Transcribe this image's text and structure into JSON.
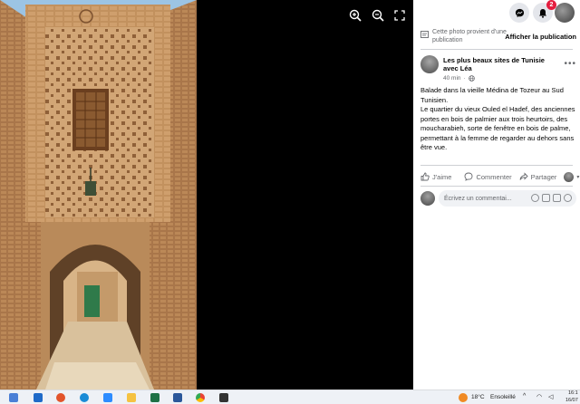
{
  "post": {
    "source_text": "Cette photo provient d'une publication",
    "source_link": "Afficher la publication",
    "author": "Les plus beaux sites de Tunisie avec Léa",
    "time": "40 min",
    "body": "Balade dans la vieille Médina de Tozeur au Sud Tunisien.\nLe quartier du vieux Ouled el Hadef, des anciennes portes en bois de palmier aux trois heurtoirs, des moucharabieh, sorte de fenêtre en bois de palme, permettant à la femme de regarder au dehors sans être vue.",
    "like_label": "J'aime",
    "comment_label": "Commenter",
    "share_label": "Partager",
    "comment_placeholder": "Écrivez un commentai..."
  },
  "topbar": {
    "notifications_count": "2"
  },
  "taskbar": {
    "weather_temp": "18°C",
    "weather_desc": "Ensoleillé",
    "time": "16:1",
    "date": "16/07"
  },
  "colors": {
    "facebook_blue": "#1877f2",
    "badge_red": "#e41e3f",
    "text_secondary": "#65676b"
  }
}
